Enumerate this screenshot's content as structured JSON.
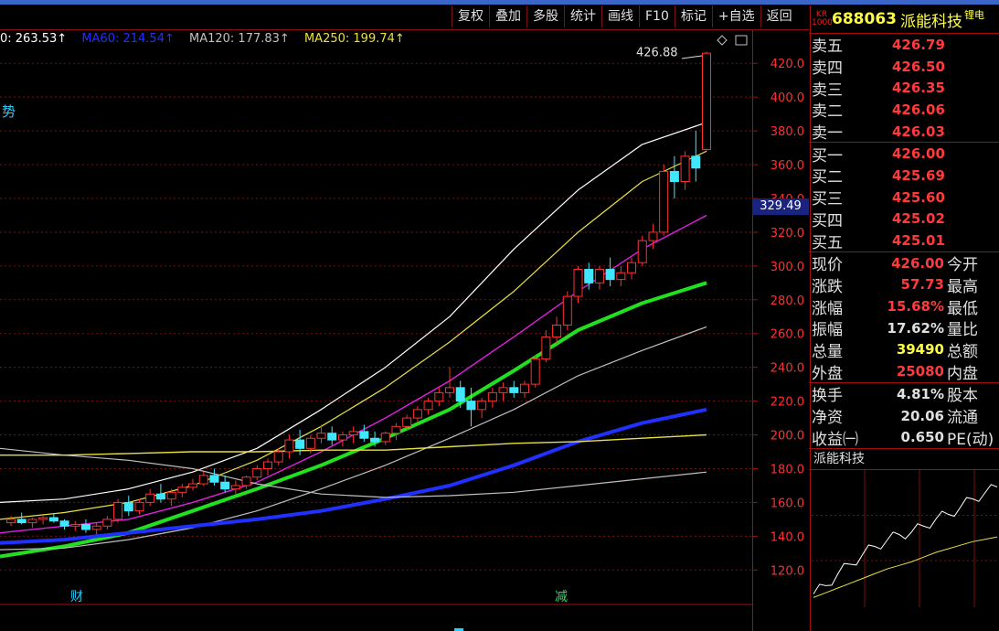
{
  "toolbar": {
    "buttons": [
      "复权",
      "叠加",
      "多股",
      "统计",
      "画线",
      "F10",
      "标记",
      "+自选",
      "返回"
    ]
  },
  "ma_legend": [
    {
      "label": "0: 263.53↑",
      "color": "#ffffff"
    },
    {
      "label": "MA60: 214.54↑",
      "color": "#2030ff"
    },
    {
      "label": "MA120: 177.83↑",
      "color": "#c0c0c0"
    },
    {
      "label": "MA250: 199.74↑",
      "color": "#e8e040"
    }
  ],
  "chart_labels": {
    "trend_text": "势",
    "peak_label": "426.88",
    "current_price_tag": "329.49",
    "marker_cai": "财",
    "marker_jian": "减"
  },
  "chart_data": {
    "type": "candlestick",
    "ylim": [
      105,
      438
    ],
    "y_ticks": [
      "420.0",
      "400.0",
      "380.0",
      "360.0",
      "340.0",
      "320.0",
      "300.0",
      "280.0",
      "260.0",
      "240.0",
      "220.0",
      "200.0",
      "180.0",
      "160.0",
      "140.0",
      "120.0"
    ],
    "candles": [
      [
        148,
        152,
        146,
        150
      ],
      [
        150,
        154,
        147,
        148
      ],
      [
        148,
        151,
        145,
        150
      ],
      [
        150,
        152,
        147,
        151
      ],
      [
        151,
        153,
        148,
        149
      ],
      [
        149,
        150,
        144,
        146
      ],
      [
        146,
        149,
        143,
        147
      ],
      [
        147,
        150,
        142,
        144
      ],
      [
        144,
        148,
        141,
        146
      ],
      [
        146,
        152,
        144,
        150
      ],
      [
        150,
        162,
        148,
        160
      ],
      [
        160,
        164,
        152,
        155
      ],
      [
        155,
        162,
        153,
        160
      ],
      [
        160,
        168,
        158,
        165
      ],
      [
        165,
        171,
        160,
        162
      ],
      [
        162,
        168,
        158,
        166
      ],
      [
        166,
        171,
        163,
        169
      ],
      [
        169,
        174,
        167,
        171
      ],
      [
        171,
        178,
        170,
        176
      ],
      [
        176,
        180,
        170,
        172
      ],
      [
        172,
        176,
        166,
        168
      ],
      [
        168,
        173,
        165,
        170
      ],
      [
        170,
        176,
        168,
        175
      ],
      [
        175,
        182,
        173,
        180
      ],
      [
        180,
        186,
        176,
        184
      ],
      [
        184,
        192,
        182,
        190
      ],
      [
        190,
        200,
        186,
        197
      ],
      [
        197,
        203,
        188,
        192
      ],
      [
        192,
        200,
        189,
        198
      ],
      [
        198,
        206,
        195,
        201
      ],
      [
        201,
        205,
        194,
        197
      ],
      [
        197,
        202,
        193,
        200
      ],
      [
        200,
        205,
        195,
        202
      ],
      [
        202,
        206,
        196,
        198
      ],
      [
        198,
        202,
        193,
        196
      ],
      [
        196,
        202,
        194,
        201
      ],
      [
        201,
        207,
        197,
        205
      ],
      [
        205,
        212,
        203,
        210
      ],
      [
        210,
        217,
        208,
        215
      ],
      [
        215,
        222,
        212,
        220
      ],
      [
        220,
        228,
        217,
        225
      ],
      [
        225,
        240,
        222,
        228
      ],
      [
        228,
        232,
        216,
        220
      ],
      [
        220,
        228,
        205,
        215
      ],
      [
        215,
        222,
        210,
        220
      ],
      [
        220,
        228,
        216,
        225
      ],
      [
        225,
        231,
        220,
        228
      ],
      [
        228,
        232,
        222,
        225
      ],
      [
        225,
        232,
        222,
        230
      ],
      [
        230,
        247,
        228,
        245
      ],
      [
        245,
        262,
        243,
        258
      ],
      [
        258,
        270,
        254,
        265
      ],
      [
        265,
        285,
        262,
        282
      ],
      [
        282,
        300,
        278,
        298
      ],
      [
        298,
        302,
        286,
        290
      ],
      [
        290,
        300,
        286,
        298
      ],
      [
        298,
        305,
        288,
        292
      ],
      [
        292,
        300,
        288,
        296
      ],
      [
        296,
        305,
        292,
        302
      ],
      [
        302,
        318,
        300,
        315
      ],
      [
        315,
        325,
        310,
        320
      ],
      [
        320,
        360,
        318,
        356
      ],
      [
        356,
        365,
        340,
        350
      ],
      [
        350,
        368,
        345,
        365
      ],
      [
        365,
        380,
        350,
        358
      ],
      [
        369,
        426.88,
        368,
        426
      ]
    ],
    "ma_series": [
      {
        "color": "#ffffff",
        "values": [
          160,
          162,
          168,
          178,
          192,
          215,
          240,
          270,
          310,
          345,
          372,
          385
        ]
      },
      {
        "color": "#e8e040",
        "values": [
          150,
          154,
          160,
          170,
          185,
          205,
          228,
          255,
          285,
          320,
          350,
          368
        ]
      },
      {
        "color": "#e020e0",
        "values": [
          142,
          146,
          150,
          160,
          172,
          190,
          210,
          232,
          258,
          285,
          310,
          330
        ]
      },
      {
        "color": "#20e020",
        "values": [
          128,
          134,
          142,
          155,
          168,
          182,
          198,
          215,
          238,
          262,
          278,
          290
        ]
      },
      {
        "color": "#c0c0c0",
        "values": [
          132,
          133,
          138,
          145,
          155,
          168,
          182,
          198,
          215,
          235,
          250,
          264
        ]
      },
      {
        "color": "#2030ff",
        "values": [
          136,
          138,
          142,
          146,
          150,
          155,
          162,
          170,
          182,
          196,
          207,
          215
        ]
      },
      {
        "color": "#c0c0c0",
        "values": [
          192,
          188,
          185,
          180,
          171,
          165,
          163,
          164,
          166,
          170,
          174,
          178
        ]
      },
      {
        "color": "#e8e040",
        "values": [
          188,
          188,
          189,
          190,
          190,
          191,
          191,
          193,
          195,
          196,
          198,
          200
        ]
      }
    ]
  },
  "stock": {
    "badge": "KR 1000",
    "code": "688063",
    "name": "派能科技",
    "sector": "锂电"
  },
  "orderbook": {
    "asks": [
      {
        "label": "卖五",
        "price": "426.79"
      },
      {
        "label": "卖四",
        "price": "426.50"
      },
      {
        "label": "卖三",
        "price": "426.35"
      },
      {
        "label": "卖二",
        "price": "426.06"
      },
      {
        "label": "卖一",
        "price": "426.03"
      }
    ],
    "bids": [
      {
        "label": "买一",
        "price": "426.00"
      },
      {
        "label": "买二",
        "price": "425.69"
      },
      {
        "label": "买三",
        "price": "425.60"
      },
      {
        "label": "买四",
        "price": "425.02"
      },
      {
        "label": "买五",
        "price": "425.01"
      }
    ]
  },
  "stats1": [
    {
      "label": "现价",
      "value": "426.00",
      "color": "#ff3a3a",
      "label2": "今开"
    },
    {
      "label": "涨跌",
      "value": "57.73",
      "color": "#ff3a3a",
      "label2": "最高"
    },
    {
      "label": "涨幅",
      "value": "15.68%",
      "color": "#ff3a3a",
      "label2": "最低"
    },
    {
      "label": "振幅",
      "value": "17.62%",
      "color": "#e0e0e0",
      "label2": "量比"
    },
    {
      "label": "总量",
      "value": "39490",
      "color": "#ffff40",
      "label2": "总额"
    },
    {
      "label": "外盘",
      "value": "25080",
      "color": "#ff3a3a",
      "label2": "内盘"
    }
  ],
  "stats2": [
    {
      "label": "换手",
      "value": "4.81%",
      "color": "#e0e0e0",
      "label2": "股本"
    },
    {
      "label": "净资",
      "value": "20.06",
      "color": "#e0e0e0",
      "label2": "流通"
    },
    {
      "label": "收益㈠",
      "value": "0.650",
      "color": "#e0e0e0",
      "label2": "PE(动)"
    }
  ],
  "mini_chart": {
    "title": "派能科技",
    "price_line": [
      0.05,
      0.12,
      0.22,
      0.3,
      0.38,
      0.45,
      0.5,
      0.55,
      0.57,
      0.62,
      0.68,
      0.72,
      0.78,
      0.85,
      0.9,
      0.95
    ],
    "avg_line": [
      0.02,
      0.06,
      0.1,
      0.14,
      0.18,
      0.22,
      0.26,
      0.29,
      0.32,
      0.36,
      0.4,
      0.43,
      0.46,
      0.49,
      0.51,
      0.53
    ]
  }
}
